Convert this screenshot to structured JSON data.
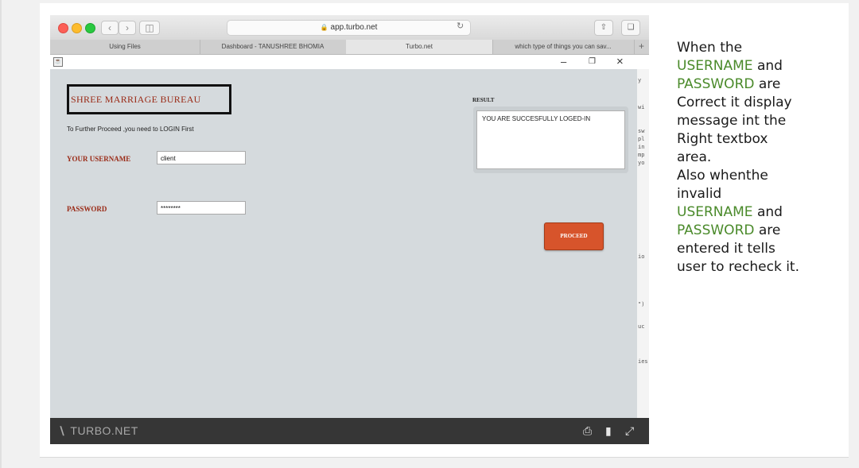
{
  "browser": {
    "url": "app.turbo.net",
    "tabs": [
      "Using Files",
      "Dashboard - TANUSHREE BHOMIA",
      "Turbo.net",
      "which type of things you can sav..."
    ],
    "active_tab_index": 2,
    "new_tab_label": "+"
  },
  "window": {
    "minimize": "–",
    "restore": "❐",
    "close": "×"
  },
  "app": {
    "title": "SHREE  MARRIAGE BUREAU",
    "hint": "To Further Proceed ,you need to LOGIN First",
    "username_label": "YOUR USERNAME",
    "username_value": "client",
    "password_label": "PASSWORD",
    "password_value": "********",
    "result_label": "RESULT",
    "result_text": "YOU ARE SUCCESFULLY LOGED-IN",
    "proceed_label": "PROCEED"
  },
  "right_strip": [
    "y",
    "wi",
    "sw",
    "pl",
    "in",
    "mp",
    "yo",
    "io",
    "\")",
    "uc",
    "ies"
  ],
  "footer": {
    "brand": "TURBO.NET",
    "icons": [
      "print-icon",
      "clipboard-icon",
      "fullscreen-icon"
    ]
  },
  "side_text": {
    "l1": "When the",
    "l2a": "USERNAME",
    "l2b": " and",
    "l3a": "PASSWORD",
    "l3b": " are",
    "l4": "Correct it display",
    "l5": "message int the",
    "l6": "Right textbox",
    "l7": "area.",
    "l8": "Also whenthe",
    "l9": "invalid",
    "l10a": "USERNAME",
    "l10b": " and",
    "l11a": "PASSWORD",
    "l11b": " are",
    "l12": "entered it tells",
    "l13": "user to recheck it."
  },
  "colors": {
    "accent_green": "#4a8a2a",
    "title_red": "#9a2a16",
    "proceed_orange": "#d7542b"
  }
}
